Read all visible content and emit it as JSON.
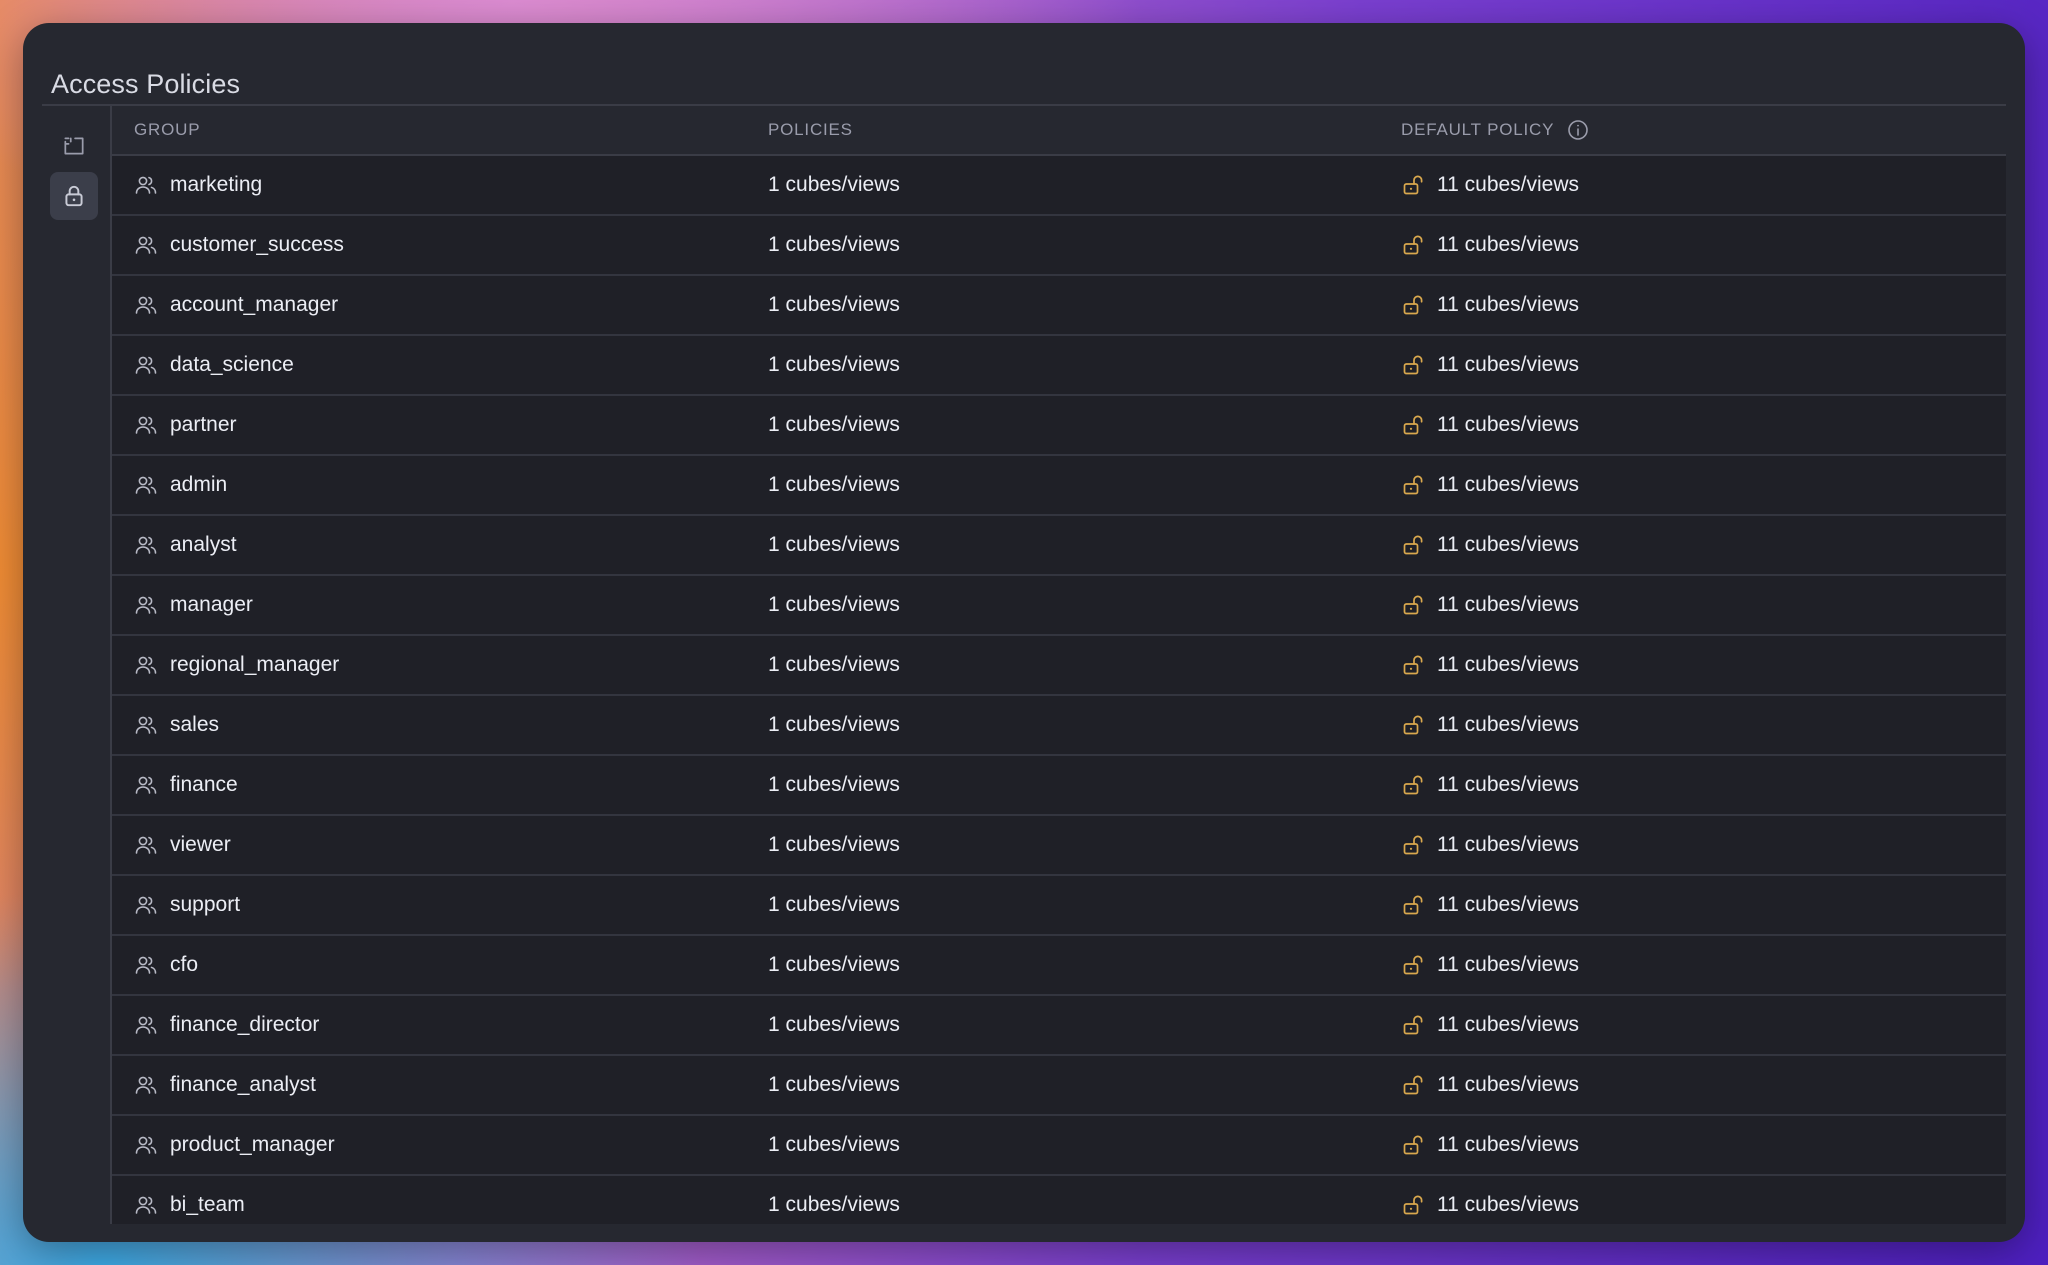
{
  "window": {
    "title": "Access Policies"
  },
  "sidebar": {
    "items": [
      {
        "icon": "frame-icon",
        "active": false
      },
      {
        "icon": "lock-icon",
        "active": true
      }
    ]
  },
  "table": {
    "columns": [
      "GROUP",
      "POLICIES",
      "DEFAULT POLICY"
    ],
    "rows": [
      {
        "group": "marketing",
        "policies": "1 cubes/views",
        "default": "11 cubes/views"
      },
      {
        "group": "customer_success",
        "policies": "1 cubes/views",
        "default": "11 cubes/views"
      },
      {
        "group": "account_manager",
        "policies": "1 cubes/views",
        "default": "11 cubes/views"
      },
      {
        "group": "data_science",
        "policies": "1 cubes/views",
        "default": "11 cubes/views"
      },
      {
        "group": "partner",
        "policies": "1 cubes/views",
        "default": "11 cubes/views"
      },
      {
        "group": "admin",
        "policies": "1 cubes/views",
        "default": "11 cubes/views"
      },
      {
        "group": "analyst",
        "policies": "1 cubes/views",
        "default": "11 cubes/views"
      },
      {
        "group": "manager",
        "policies": "1 cubes/views",
        "default": "11 cubes/views"
      },
      {
        "group": "regional_manager",
        "policies": "1 cubes/views",
        "default": "11 cubes/views"
      },
      {
        "group": "sales",
        "policies": "1 cubes/views",
        "default": "11 cubes/views"
      },
      {
        "group": "finance",
        "policies": "1 cubes/views",
        "default": "11 cubes/views"
      },
      {
        "group": "viewer",
        "policies": "1 cubes/views",
        "default": "11 cubes/views"
      },
      {
        "group": "support",
        "policies": "1 cubes/views",
        "default": "11 cubes/views"
      },
      {
        "group": "cfo",
        "policies": "1 cubes/views",
        "default": "11 cubes/views"
      },
      {
        "group": "finance_director",
        "policies": "1 cubes/views",
        "default": "11 cubes/views"
      },
      {
        "group": "finance_analyst",
        "policies": "1 cubes/views",
        "default": "11 cubes/views"
      },
      {
        "group": "product_manager",
        "policies": "1 cubes/views",
        "default": "11 cubes/views"
      },
      {
        "group": "bi_team",
        "policies": "1 cubes/views",
        "default": "11 cubes/views"
      }
    ]
  },
  "colors": {
    "lock_open": "#d9a84e",
    "window_bg": "#262830",
    "table_bg": "#1f2027"
  }
}
